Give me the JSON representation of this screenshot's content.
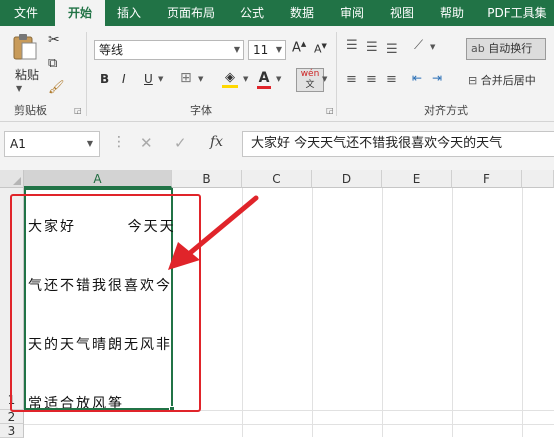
{
  "tabs": [
    "文件",
    "开始",
    "插入",
    "页面布局",
    "公式",
    "数据",
    "审阅",
    "视图",
    "帮助",
    "PDF工具集"
  ],
  "active_tab": "开始",
  "clipboard": {
    "paste_label": "粘贴",
    "group_label": "剪贴板"
  },
  "font": {
    "font_name": "等线",
    "font_size": "11",
    "bold": "B",
    "italic": "I",
    "underline": "U",
    "grow": "A",
    "shrink": "A",
    "font_color": "A",
    "phonetic": "wén",
    "group_label": "字体"
  },
  "alignment": {
    "wrap_text": "自动换行",
    "merge_center": "合并后居中",
    "group_label": "对齐方式"
  },
  "formula_bar": {
    "name_box": "A1",
    "fx": "fx",
    "content": "大家好       今天天气还不错我很喜欢今天的天气"
  },
  "columns": [
    "A",
    "B",
    "C",
    "D",
    "E",
    "F"
  ],
  "rows": [
    "1",
    "2",
    "3"
  ],
  "cell_a1_lines": [
    "大家好        今天天",
    "气还不错我很喜欢今",
    "天的天气晴朗无风非",
    "常适合放风筝"
  ],
  "colors": {
    "ribbon_green": "#217346",
    "annotation_red": "#e0242a"
  }
}
